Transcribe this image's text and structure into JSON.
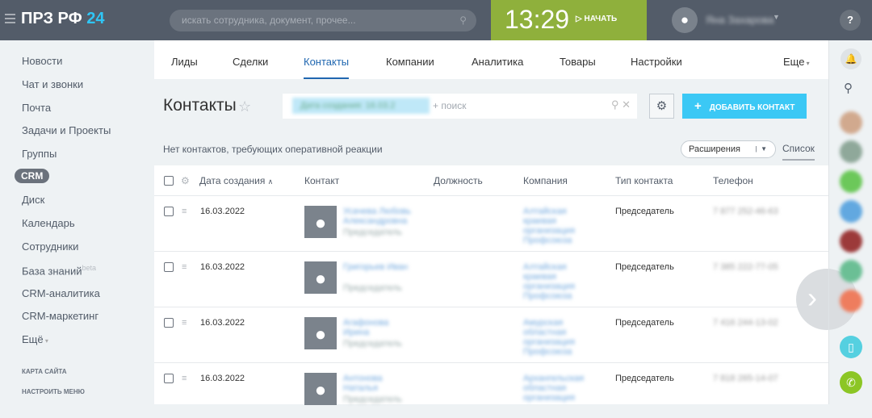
{
  "header": {
    "logo_main": "ПРЗ РФ",
    "logo_accent": "24",
    "search_placeholder": "искать сотрудника, документ, прочее...",
    "time": "13:29",
    "start_label": "НАЧАТЬ",
    "user_name": "Яна Захарова"
  },
  "sidebar": {
    "items": [
      "Новости",
      "Чат и звонки",
      "Почта",
      "Задачи и Проекты",
      "Группы",
      "CRM",
      "Диск",
      "Календарь",
      "Сотрудники",
      "База знаний",
      "CRM-аналитика",
      "CRM-маркетинг",
      "Ещё"
    ],
    "beta": "beta",
    "sitemap": "КАРТА САЙТА",
    "configure": "НАСТРОИТЬ МЕНЮ"
  },
  "tabs": [
    "Лиды",
    "Сделки",
    "Контакты",
    "Компании",
    "Аналитика",
    "Товары",
    "Настройки",
    "Еще"
  ],
  "page": {
    "title": "Контакты",
    "filter_chip": "Дата создания: 16.03.2",
    "search_placeholder": "+ поиск",
    "add_button": "ДОБАВИТЬ КОНТАКТ",
    "notice": "Нет контактов, требующих оперативной реакции",
    "extensions": "Расширения",
    "list_view": "Список"
  },
  "table": {
    "columns": [
      "Дата создания",
      "Контакт",
      "Должность",
      "Компания",
      "Тип контакта",
      "Телефон"
    ],
    "rows": [
      {
        "date": "16.03.2022",
        "name": "Усачева Любовь Александровна",
        "post": "Председатель",
        "company": "Алтайская краевая организация Профсоюза",
        "type": "Председатель",
        "phone": "7 877 252-46-63"
      },
      {
        "date": "16.03.2022",
        "name": "Григорьев Иван",
        "post": "Председатель",
        "company": "Алтайская краевая организация Профсоюза",
        "type": "Председатель",
        "phone": "7 385 222-77-05"
      },
      {
        "date": "16.03.2022",
        "name": "Агафонова Ирина",
        "post": "Председатель",
        "company": "Амурская областная организация Профсоюза",
        "type": "Председатель",
        "phone": "7 416 244-13-02"
      },
      {
        "date": "16.03.2022",
        "name": "Антонова Наталья",
        "post": "Председатель",
        "company": "Архангельская областная организация",
        "type": "Председатель",
        "phone": "7 818 265-14-07"
      }
    ]
  },
  "colors": {
    "topbar": "#535c69",
    "accent": "#3bc8f5",
    "clock": "#8fb03c",
    "link": "#2067b0"
  }
}
